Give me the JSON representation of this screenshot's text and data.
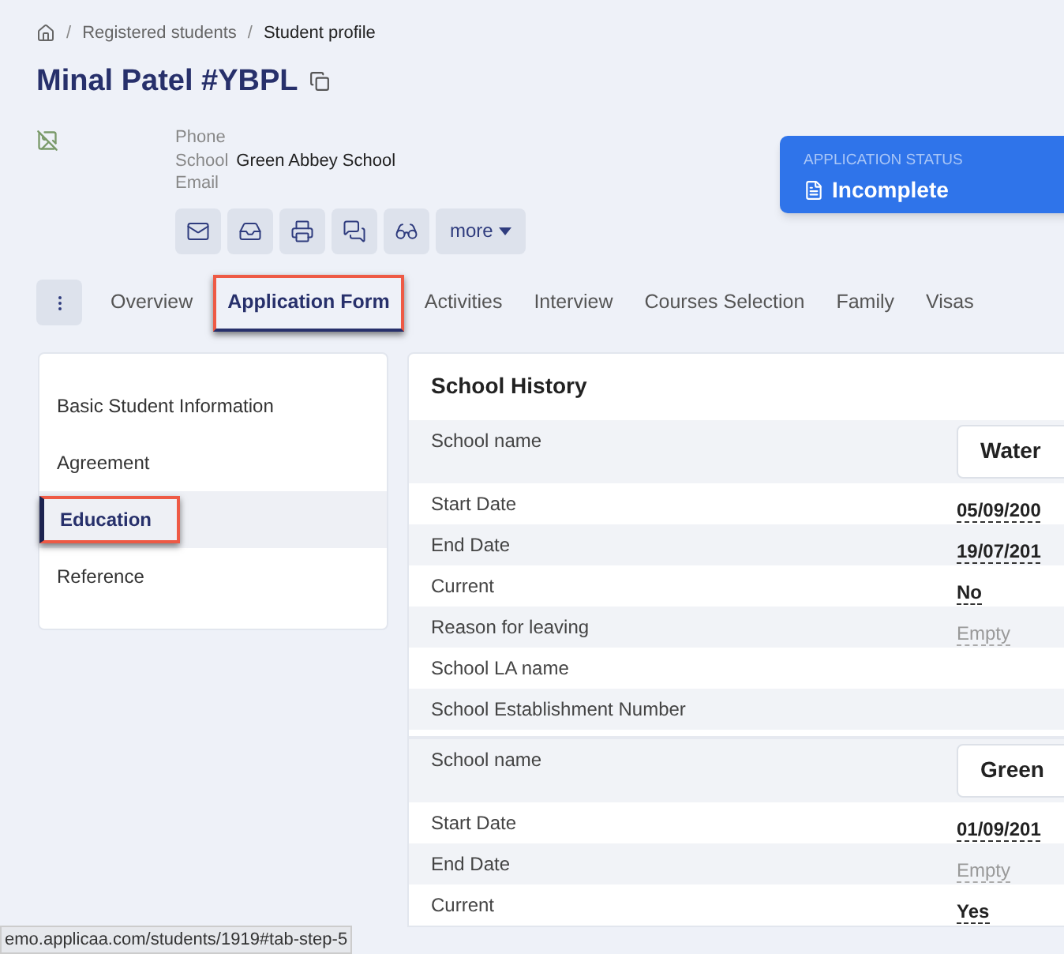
{
  "breadcrumb_separator": "/",
  "breadcrumb": [
    {
      "label": "Registered students",
      "kind": "link"
    },
    {
      "label": "Student profile",
      "kind": "current"
    }
  ],
  "title": "Minal Patel #YBPL",
  "profile": [
    {
      "label": "Phone"
    },
    {
      "label": "School",
      "value": "Green Abbey School"
    },
    {
      "label": "Email"
    }
  ],
  "actions": {
    "more": "more"
  },
  "status": {
    "label": "APPLICATION STATUS",
    "value": "Incomplete"
  },
  "tabs": [
    {
      "label": "Overview",
      "selected": false,
      "highlighted": false
    },
    {
      "label": "Application Form",
      "selected": true,
      "highlighted": true
    },
    {
      "label": "Activities",
      "selected": false,
      "highlighted": false
    },
    {
      "label": "Interview",
      "selected": false,
      "highlighted": false
    },
    {
      "label": "Courses Selection",
      "selected": false,
      "highlighted": false
    },
    {
      "label": "Family",
      "selected": false,
      "highlighted": false
    },
    {
      "label": "Visas",
      "selected": false,
      "highlighted": false
    }
  ],
  "sidebar": {
    "items": [
      {
        "label": "Basic Student Information",
        "selected": false,
        "highlighted": false
      },
      {
        "label": "Agreement",
        "selected": false,
        "highlighted": false
      },
      {
        "label": "Education",
        "selected": true,
        "highlighted": true
      },
      {
        "label": "Reference",
        "selected": false,
        "highlighted": false
      }
    ]
  },
  "panel": {
    "title": "School History",
    "groups": [
      {
        "rows": [
          {
            "label": "School name",
            "kind": "field",
            "value": "Water"
          },
          {
            "label": "Start Date",
            "kind": "date",
            "value": "05/09/200"
          },
          {
            "label": "End Date",
            "kind": "date",
            "value": "19/07/201"
          },
          {
            "label": "Current",
            "kind": "date",
            "value": "No"
          },
          {
            "label": "Reason for leaving",
            "kind": "empty",
            "value": "Empty"
          },
          {
            "label": "School LA name",
            "kind": "none"
          },
          {
            "label": "School Establishment Number",
            "kind": "none"
          }
        ]
      },
      {
        "rows": [
          {
            "label": "School name",
            "kind": "field",
            "value": "Green"
          },
          {
            "label": "Start Date",
            "kind": "date",
            "value": "01/09/201"
          },
          {
            "label": "End Date",
            "kind": "empty",
            "value": "Empty"
          },
          {
            "label": "Current",
            "kind": "date",
            "value": "Yes"
          }
        ]
      }
    ]
  },
  "status_bar": "emo.applicaa.com/students/1919#tab-step-5"
}
